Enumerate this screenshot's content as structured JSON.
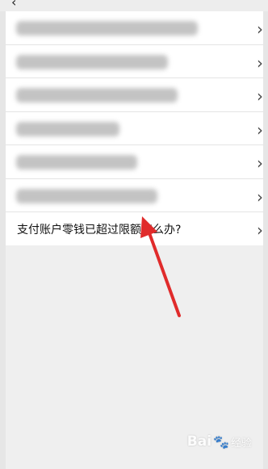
{
  "header": {
    "back_icon": "chevron-left-icon",
    "title": ""
  },
  "list": {
    "rows": [
      {
        "label": "",
        "blurred": true
      },
      {
        "label": "",
        "blurred": true
      },
      {
        "label": "",
        "blurred": true
      },
      {
        "label": "",
        "blurred": true
      },
      {
        "label": "",
        "blurred": true
      },
      {
        "label": "",
        "blurred": true
      },
      {
        "label": "支付账户零钱已超过限额怎么办?",
        "blurred": false
      }
    ],
    "chevron_glyph": "›"
  },
  "annotation": {
    "arrow_color": "#e02b2b",
    "points_to": "row-7"
  },
  "watermark": {
    "logo_left": "Bai",
    "logo_right": "经验",
    "paw_glyph": "🐾"
  }
}
